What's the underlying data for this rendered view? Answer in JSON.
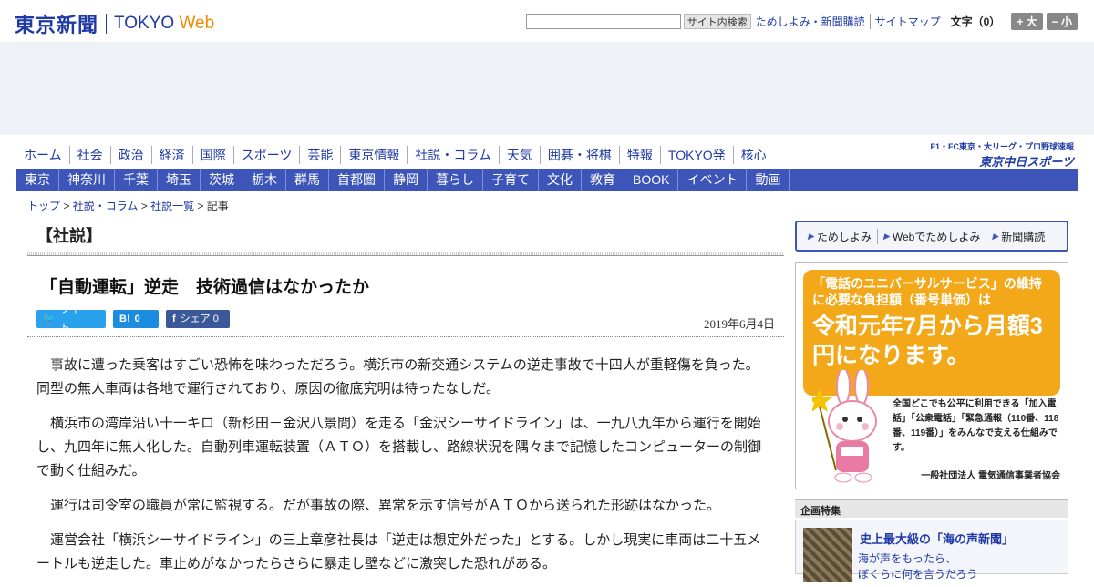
{
  "header": {
    "logo_jp": "東京新聞",
    "logo_en_main": "TOKYO",
    "logo_en_accent": " Web",
    "search_button": "サイト内検索",
    "links": [
      "ためしよみ・新聞購読",
      "サイトマップ"
    ],
    "font_size_label": "文字（0）",
    "font_larger": "+ 大",
    "font_smaller": "− 小"
  },
  "nav_primary": [
    "ホーム",
    "社会",
    "政治",
    "経済",
    "国際",
    "スポーツ",
    "芸能",
    "東京情報",
    "社説・コラム",
    "天気",
    "囲碁・将棋",
    "特報",
    "TOKYO発",
    "核心"
  ],
  "nav_secondary": [
    "東京",
    "神奈川",
    "千葉",
    "埼玉",
    "茨城",
    "栃木",
    "群馬",
    "首都圏",
    "静岡",
    "暮らし",
    "子育て",
    "文化",
    "教育",
    "BOOK",
    "イベント",
    "動画"
  ],
  "chunichi_banner": {
    "line1": "F1・FC東京・大リーグ・プロ野球速報",
    "line2": "東京中日スポーツ"
  },
  "breadcrumb": [
    "トップ",
    "社説・コラム",
    "社説一覧",
    "記事"
  ],
  "article": {
    "section": "【社説】",
    "headline": "「自動運転」逆走　技術過信はなかったか",
    "share": {
      "tweet": "ツイート",
      "hatena_icon": "B!",
      "hatena_count": "0",
      "fb_label": "シェア",
      "fb_count": "0"
    },
    "date": "2019年6月4日",
    "paragraphs": [
      "事故に遭った乗客はすごい恐怖を味わっただろう。横浜市の新交通システムの逆走事故で十四人が重軽傷を負った。同型の無人車両は各地で運行されており、原因の徹底究明は待ったなしだ。",
      "横浜市の湾岸沿い十一キロ（新杉田－金沢八景間）を走る「金沢シーサイドライン」は、一九八九年から運行を開始し、九四年に無人化した。自動列車運転装置（ＡＴＯ）を搭載し、路線状況を隅々まで記憶したコンピューターの制御で動く仕組みだ。",
      "運行は司令室の職員が常に監視する。だが事故の際、異常を示す信号がＡＴＯから送られた形跡はなかった。",
      "運営会社「横浜シーサイドライン」の三上章彦社長は「逆走は想定外だった」とする。しかし現実に車両は二十五メートルも逆走した。車止めがなかったらさらに暴走し壁などに激突した恐れがある。"
    ]
  },
  "sidebar": {
    "tabs": [
      "ためしよみ",
      "Webでためしよみ",
      "新聞購読"
    ],
    "ad": {
      "headline": "「電話のユニバーサルサービス」の維持に必要な負担額（番号単価）は",
      "big": "令和元年7月から月額3円になります。",
      "body": "全国どこでも公平に利用できる「加入電話」「公衆電話」「緊急通報（110番、118番、119番）」をみんなで支える仕組みです。",
      "org": "一般社団法人 電気通信事業者協会"
    },
    "feature_header": "企画特集",
    "feature_title": "史上最大級の「海の声新聞」",
    "feature_desc_1": "海が声をもったら、",
    "feature_desc_2": "ぼくらに何を言うだろう"
  }
}
